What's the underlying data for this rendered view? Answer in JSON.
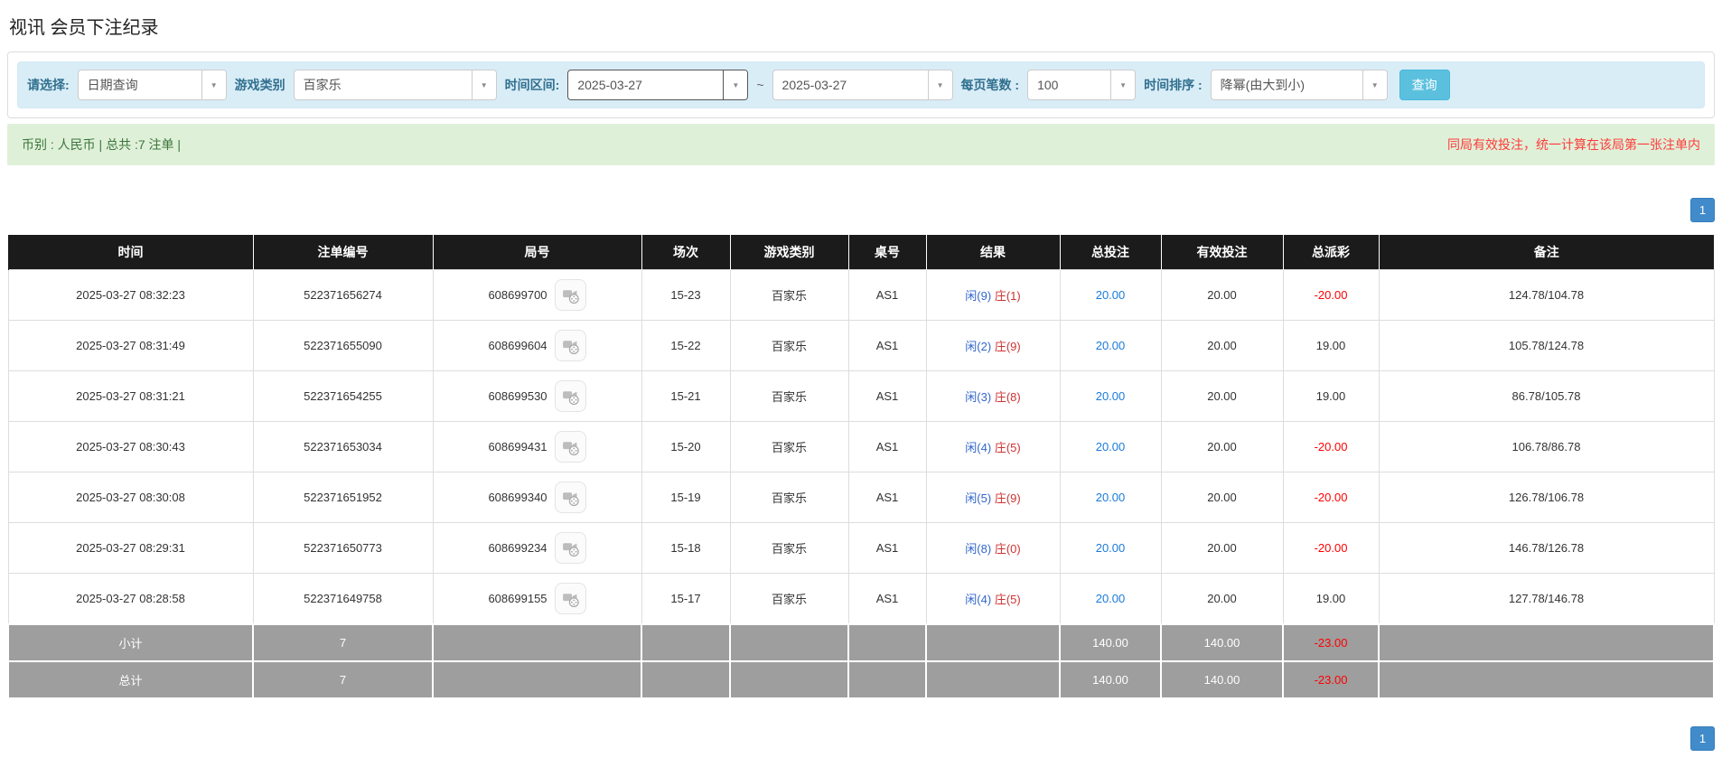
{
  "page": {
    "title": "视讯 会员下注纪录"
  },
  "filters": {
    "query_type_label": "请选择:",
    "query_type_value": "日期查询",
    "game_type_label": "游戏类别",
    "game_type_value": "百家乐",
    "time_range_label": "时间区间:",
    "date_from": "2025-03-27",
    "date_separator": "~",
    "date_to": "2025-03-27",
    "page_size_label": "每页笔数 :",
    "page_size_value": "100",
    "sort_label": "时间排序 :",
    "sort_value": "降幂(由大到小)",
    "search_button": "查询"
  },
  "summary_bar": {
    "left_text": "币别 : 人民币 | 总共 :7 注单 |",
    "right_text": "同局有效投注，统一计算在该局第一张注单内"
  },
  "pagination": {
    "page": "1"
  },
  "table": {
    "columns": [
      "时间",
      "注单编号",
      "局号",
      "场次",
      "游戏类别",
      "桌号",
      "结果",
      "总投注",
      "有效投注",
      "总派彩",
      "备注"
    ],
    "rows": [
      {
        "time": "2025-03-27 08:32:23",
        "bet_id": "522371656274",
        "round": "608699700",
        "session": "15-23",
        "game": "百家乐",
        "table_no": "AS1",
        "result_player": "闲(9)",
        "result_banker": "庄(1)",
        "total_bet": "20.00",
        "valid_bet": "20.00",
        "payout": "-20.00",
        "remark": "124.78/104.78"
      },
      {
        "time": "2025-03-27 08:31:49",
        "bet_id": "522371655090",
        "round": "608699604",
        "session": "15-22",
        "game": "百家乐",
        "table_no": "AS1",
        "result_player": "闲(2)",
        "result_banker": "庄(9)",
        "total_bet": "20.00",
        "valid_bet": "20.00",
        "payout": "19.00",
        "remark": "105.78/124.78"
      },
      {
        "time": "2025-03-27 08:31:21",
        "bet_id": "522371654255",
        "round": "608699530",
        "session": "15-21",
        "game": "百家乐",
        "table_no": "AS1",
        "result_player": "闲(3)",
        "result_banker": "庄(8)",
        "total_bet": "20.00",
        "valid_bet": "20.00",
        "payout": "19.00",
        "remark": "86.78/105.78"
      },
      {
        "time": "2025-03-27 08:30:43",
        "bet_id": "522371653034",
        "round": "608699431",
        "session": "15-20",
        "game": "百家乐",
        "table_no": "AS1",
        "result_player": "闲(4)",
        "result_banker": "庄(5)",
        "total_bet": "20.00",
        "valid_bet": "20.00",
        "payout": "-20.00",
        "remark": "106.78/86.78"
      },
      {
        "time": "2025-03-27 08:30:08",
        "bet_id": "522371651952",
        "round": "608699340",
        "session": "15-19",
        "game": "百家乐",
        "table_no": "AS1",
        "result_player": "闲(5)",
        "result_banker": "庄(9)",
        "total_bet": "20.00",
        "valid_bet": "20.00",
        "payout": "-20.00",
        "remark": "126.78/106.78"
      },
      {
        "time": "2025-03-27 08:29:31",
        "bet_id": "522371650773",
        "round": "608699234",
        "session": "15-18",
        "game": "百家乐",
        "table_no": "AS1",
        "result_player": "闲(8)",
        "result_banker": "庄(0)",
        "total_bet": "20.00",
        "valid_bet": "20.00",
        "payout": "-20.00",
        "remark": "146.78/126.78"
      },
      {
        "time": "2025-03-27 08:28:58",
        "bet_id": "522371649758",
        "round": "608699155",
        "session": "15-17",
        "game": "百家乐",
        "table_no": "AS1",
        "result_player": "闲(4)",
        "result_banker": "庄(5)",
        "total_bet": "20.00",
        "valid_bet": "20.00",
        "payout": "19.00",
        "remark": "127.78/146.78"
      }
    ],
    "subtotal": {
      "label": "小计",
      "count": "7",
      "total_bet": "140.00",
      "valid_bet": "140.00",
      "payout": "-23.00",
      "remark": ""
    },
    "total": {
      "label": "总计",
      "count": "7",
      "total_bet": "140.00",
      "valid_bet": "140.00",
      "payout": "-23.00",
      "remark": ""
    }
  },
  "icons": {
    "dropdown_caret": "▼",
    "video_replay": "video-camera-with-film-reel"
  },
  "colors": {
    "filter_bar_bg": "#d9edf7",
    "filter_label": "#31708f",
    "success_bar_bg": "#dff0d8",
    "success_text": "#3c763d",
    "notice_red": "#ff3b3b",
    "header_bg": "#1b1b1b",
    "summary_row_bg": "#9e9e9e",
    "player_blue": "#3366cc",
    "banker_red": "#cc3333",
    "bet_link_blue": "#1a7ad9",
    "negative_red": "#ff0000",
    "pager_blue": "#428bca",
    "query_button_blue": "#5bc0de"
  }
}
